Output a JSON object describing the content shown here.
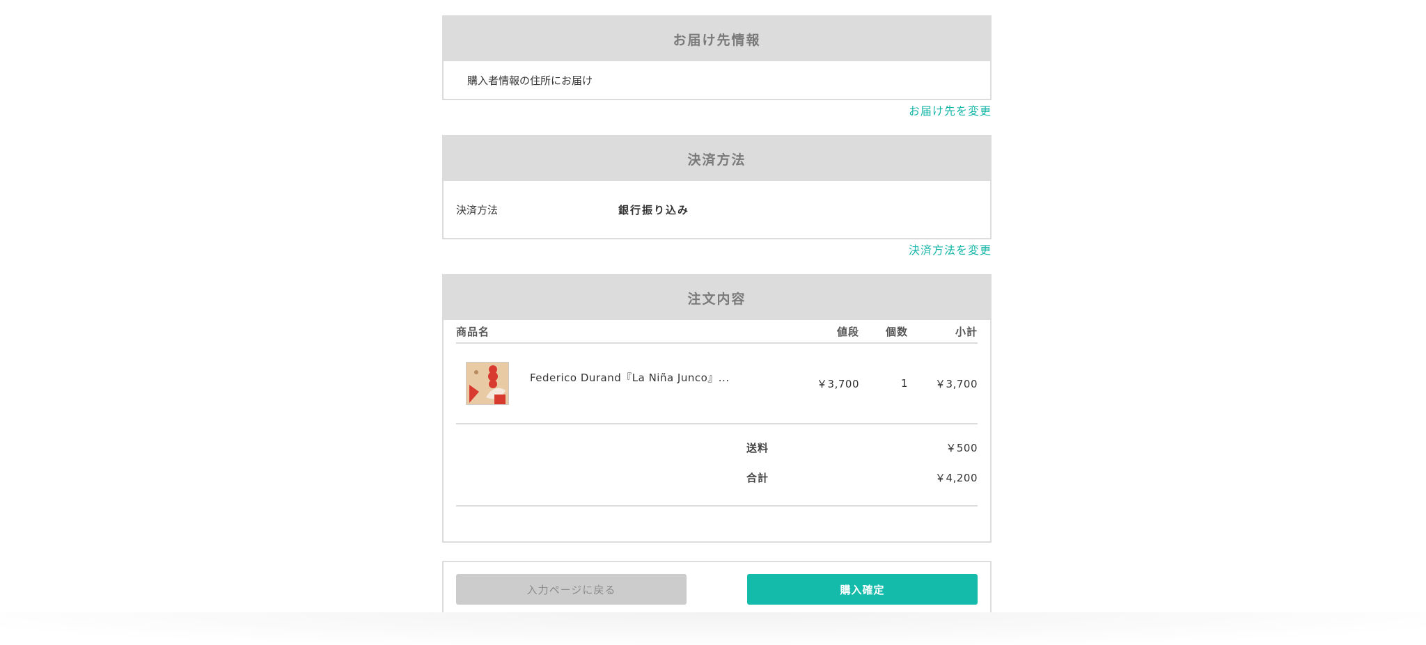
{
  "delivery": {
    "title": "お届け先情報",
    "info": "購入者情報の住所にお届け",
    "change_link": "お届け先を変更"
  },
  "payment": {
    "title": "決済方法",
    "label": "決済方法",
    "value": "銀行振り込み",
    "change_link": "決済方法を変更"
  },
  "order": {
    "title": "注文内容",
    "columns": {
      "name": "商品名",
      "price": "値段",
      "qty": "個数",
      "subtotal": "小計"
    },
    "items": [
      {
        "name": "Federico Durand『La Niña Junco』...",
        "price": "￥3,700",
        "qty": "1",
        "subtotal": "￥3,700",
        "thumbnail_icon": "album-cover-thumbnail"
      }
    ],
    "shipping_label": "送料",
    "shipping_value": "￥500",
    "total_label": "合計",
    "total_value": "￥4,200"
  },
  "actions": {
    "back_label": "入力ページに戻る",
    "confirm_label": "購入確定"
  },
  "colors": {
    "accent": "#14bbaa",
    "header_bg": "#dcdcdc",
    "link": "#14b6a8"
  }
}
